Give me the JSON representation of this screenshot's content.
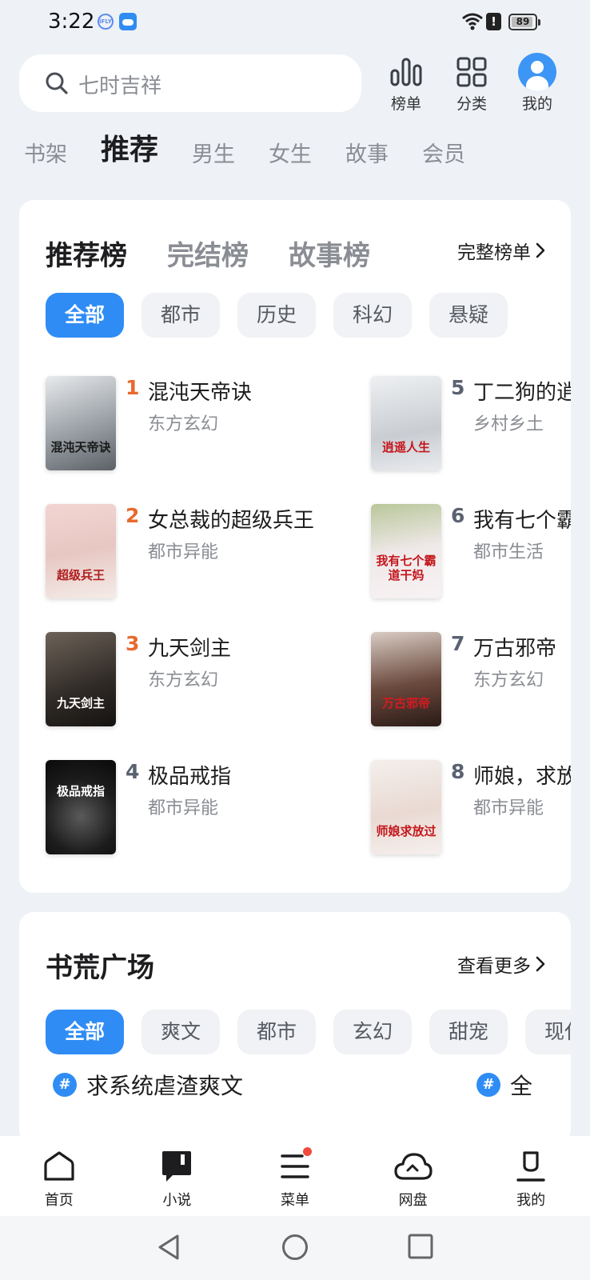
{
  "status_bar": {
    "time": "3:22",
    "battery": "89"
  },
  "search": {
    "placeholder": "七时吉祥",
    "icon": "search-icon"
  },
  "top_actions": [
    {
      "label": "榜单",
      "icon": "bar-chart-icon"
    },
    {
      "label": "分类",
      "icon": "grid-icon"
    },
    {
      "label": "我的",
      "icon": "avatar-icon"
    }
  ],
  "category_tabs": [
    {
      "label": "书架",
      "active": false
    },
    {
      "label": "推荐",
      "active": true
    },
    {
      "label": "男生",
      "active": false
    },
    {
      "label": "女生",
      "active": false
    },
    {
      "label": "故事",
      "active": false
    },
    {
      "label": "会员",
      "active": false
    }
  ],
  "rank_card": {
    "tabs": [
      {
        "label": "推荐榜",
        "active": true
      },
      {
        "label": "完结榜",
        "active": false
      },
      {
        "label": "故事榜",
        "active": false
      }
    ],
    "more_label": "完整榜单",
    "chips": [
      {
        "label": "全部",
        "active": true
      },
      {
        "label": "都市",
        "active": false
      },
      {
        "label": "历史",
        "active": false
      },
      {
        "label": "科幻",
        "active": false
      },
      {
        "label": "悬疑",
        "active": false
      }
    ],
    "books": [
      {
        "rank": "1",
        "title": "混沌天帝诀",
        "genre": "东方玄幻",
        "cover_text": "混沌天帝诀"
      },
      {
        "rank": "2",
        "title": "女总裁的超级兵王",
        "genre": "都市异能",
        "cover_text": "超级兵王"
      },
      {
        "rank": "3",
        "title": "九天剑主",
        "genre": "东方玄幻",
        "cover_text": "九天剑主"
      },
      {
        "rank": "4",
        "title": "极品戒指",
        "genre": "都市异能",
        "cover_text": "极品戒指"
      },
      {
        "rank": "5",
        "title": "丁二狗的逍",
        "genre": "乡村乡土",
        "cover_text": "逍遥人生"
      },
      {
        "rank": "6",
        "title": "我有七个霸",
        "genre": "都市生活",
        "cover_text": "我有七个霸道干妈"
      },
      {
        "rank": "7",
        "title": "万古邪帝",
        "genre": "东方玄幻",
        "cover_text": "万古邪帝"
      },
      {
        "rank": "8",
        "title": "师娘，求放",
        "genre": "都市异能",
        "cover_text": "师娘求放过"
      }
    ]
  },
  "square_card": {
    "title": "书荒广场",
    "more_label": "查看更多",
    "chips": [
      {
        "label": "全部",
        "active": true
      },
      {
        "label": "爽文",
        "active": false
      },
      {
        "label": "都市",
        "active": false
      },
      {
        "label": "玄幻",
        "active": false
      },
      {
        "label": "甜宠",
        "active": false
      },
      {
        "label": "现代",
        "active": false
      }
    ],
    "topics": [
      {
        "label": "求系统虐渣爽文"
      },
      {
        "label": "全"
      }
    ]
  },
  "bottom_nav": [
    {
      "label": "首页",
      "icon": "home-icon"
    },
    {
      "label": "小说",
      "icon": "book-icon"
    },
    {
      "label": "菜单",
      "icon": "menu-icon",
      "badge": true
    },
    {
      "label": "网盘",
      "icon": "cloud-icon"
    },
    {
      "label": "我的",
      "icon": "profile-icon"
    }
  ],
  "colors": {
    "accent": "#2f8cf5",
    "rank_top": "#e8692c",
    "rank_normal": "#5a6270",
    "background": "#eef1f6"
  }
}
